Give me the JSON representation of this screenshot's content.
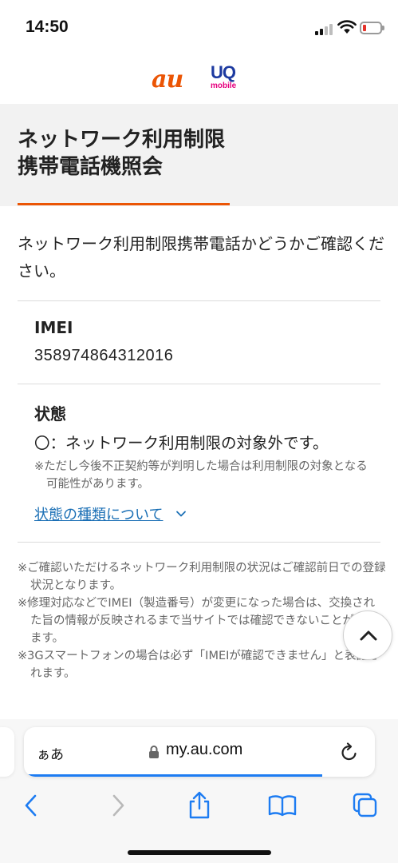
{
  "status_bar": {
    "time": "14:50",
    "icons": [
      "signal-icon",
      "wifi-icon",
      "battery-icon"
    ],
    "battery_color": "#e5332a"
  },
  "brand": {
    "au_logo": "au",
    "uq_logo": "UQ",
    "uq_sub": "mobile",
    "au_color": "#eb5505",
    "uq_color": "#1d3aa0",
    "mobile_color": "#e6007e"
  },
  "header": {
    "title_line1": "ネットワーク利用制限",
    "title_line2": "携帯電話機照会",
    "accent_color": "#eb5505"
  },
  "intro": "ネットワーク利用制限携帯電話かどうかご確認ください。",
  "imei": {
    "label": "IMEI",
    "value": "358974864312016"
  },
  "state": {
    "label": "状態",
    "text": "〇：ネットワーク利用制限の対象外です。",
    "note": "※ただし今後不正契約等が判明した場合は利用制限の対象となる可能性があります。",
    "link": "状態の種類について",
    "link_color": "#1a6fb5"
  },
  "notes": [
    "※ご確認いただけるネットワーク利用制限の状況はご確認前日での登録状況となります。",
    "※修理対応などでIMEI（製造番号）が変更になった場合は、交換された旨の情報が反映されるまで当サイトでは確認できないことがあります。",
    "※3Gスマートフォンの場合は必ず「IMEIが確認できません」と表記されます。"
  ],
  "browser": {
    "reader_label": "ぁあ",
    "url": "my.au.com",
    "load_progress": 0.85,
    "progress_color": "#1d7cf2",
    "toolbar_icons": [
      "back-icon",
      "forward-icon",
      "share-icon",
      "bookmarks-icon",
      "tabs-icon"
    ],
    "accent_color": "#1d7cf2"
  }
}
